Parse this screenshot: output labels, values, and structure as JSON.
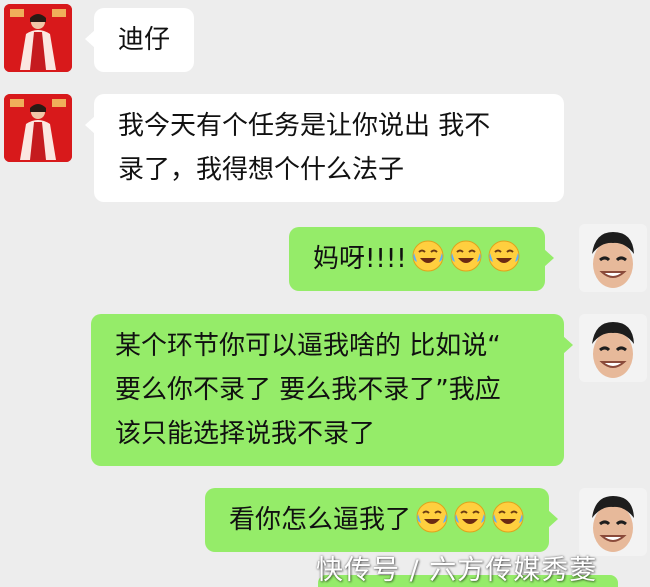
{
  "messages": [
    {
      "side": "left",
      "lines": [
        "迪仔"
      ]
    },
    {
      "side": "left",
      "lines": [
        "我今天有个任务是让你说出 我不",
        "录了，我得想个什么法子"
      ]
    },
    {
      "side": "right",
      "text": "妈呀!!!!"
    },
    {
      "side": "right",
      "lines": [
        "某个环节你可以逼我啥的 比如说“",
        "要么你不录了 要么我不录了”我应",
        "该只能选择说我不录了"
      ]
    },
    {
      "side": "right",
      "text": "看你怎么逼我了"
    }
  ],
  "watermark": "快传号 / 六方传媒秀菱",
  "icons": {
    "sender_avatar": "portrait-red-avatar",
    "self_avatar": "smiling-man-avatar",
    "emoji": "tears-of-joy-emoji"
  }
}
